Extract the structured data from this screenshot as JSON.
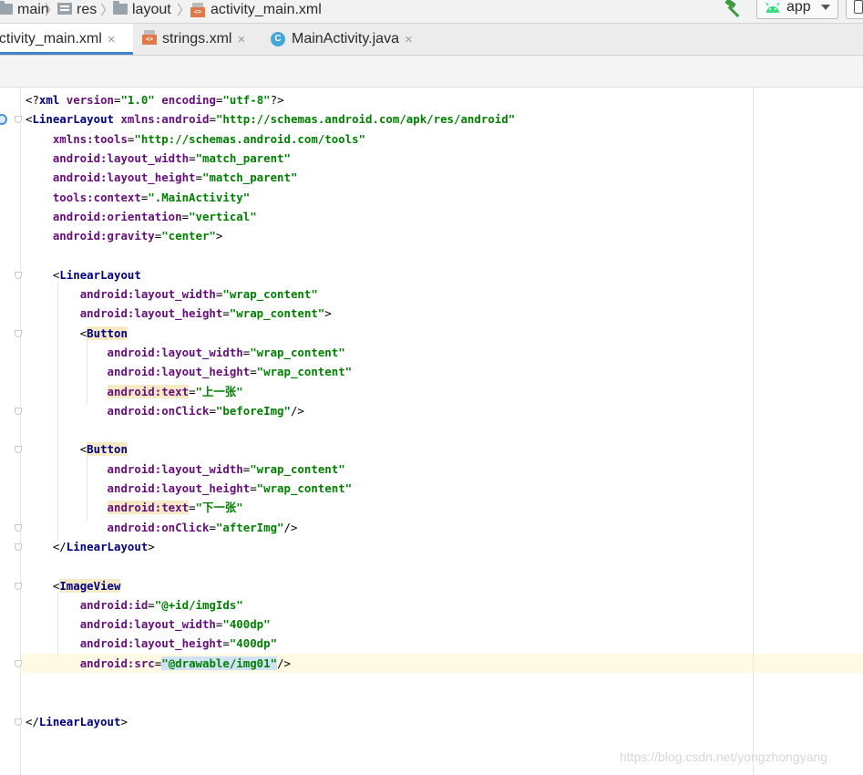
{
  "breadcrumb": [
    {
      "label": "main",
      "icon": "folder-icon"
    },
    {
      "label": "res",
      "icon": "resource-folder-icon"
    },
    {
      "label": "layout",
      "icon": "folder-icon"
    },
    {
      "label": "activity_main.xml",
      "icon": "xml-file-icon"
    }
  ],
  "toolbar": {
    "run_config": "app",
    "build_icon": "hammer-icon",
    "config_icon": "android-icon",
    "accent": "#4083c9"
  },
  "tabs": [
    {
      "label": "activity_main.xml",
      "icon": "xml-file-icon",
      "active": true
    },
    {
      "label": "strings.xml",
      "icon": "xml-file-icon",
      "active": false
    },
    {
      "label": "MainActivity.java",
      "icon": "java-class-icon",
      "icon_glyph": "C",
      "active": false
    }
  ],
  "xml_badge": "<>",
  "close_glyph": "×",
  "editor": {
    "language": "XML",
    "lines": [
      "<?xml version=\"1.0\" encoding=\"utf-8\"?>",
      "<LinearLayout xmlns:android=\"http://schemas.android.com/apk/res/android\"",
      "    xmlns:tools=\"http://schemas.android.com/tools\"",
      "    android:layout_width=\"match_parent\"",
      "    android:layout_height=\"match_parent\"",
      "    tools:context=\".MainActivity\"",
      "    android:orientation=\"vertical\"",
      "    android:gravity=\"center\">",
      "",
      "    <LinearLayout",
      "        android:layout_width=\"wrap_content\"",
      "        android:layout_height=\"wrap_content\">",
      "        <Button",
      "            android:layout_width=\"wrap_content\"",
      "            android:layout_height=\"wrap_content\"",
      "            android:text=\"上一张\"",
      "            android:onClick=\"beforeImg\"/>",
      "",
      "        <Button",
      "            android:layout_width=\"wrap_content\"",
      "            android:layout_height=\"wrap_content\"",
      "            android:text=\"下一张\"",
      "            android:onClick=\"afterImg\"/>",
      "    </LinearLayout>",
      "",
      "    <ImageView",
      "        android:id=\"@+id/imgIds\"",
      "        android:layout_width=\"400dp\"",
      "        android:layout_height=\"400dp\"",
      "        android:src=\"@drawable/img01\"/>",
      "",
      "",
      "</LinearLayout>"
    ],
    "current_line": 30
  },
  "watermark": "https://blog.csdn.net/yongzhongyang"
}
